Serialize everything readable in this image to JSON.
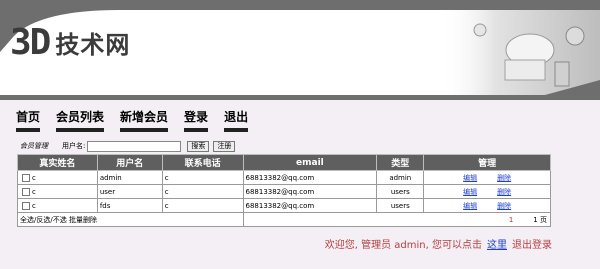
{
  "brand": {
    "mark": "3D",
    "name": "技术网"
  },
  "nav": {
    "items": [
      "首页",
      "会员列表",
      "新增会员",
      "登录",
      "退出"
    ]
  },
  "toolbar": {
    "title": "会员管理",
    "username_label": "用户名:",
    "search_value": "",
    "search_label": "搜索",
    "register_label": "注册"
  },
  "table": {
    "headers": [
      "真实姓名",
      "用户名",
      "联系电话",
      "email",
      "类型",
      "管理"
    ],
    "rows": [
      {
        "realname": "c",
        "username": "admin",
        "phone": "c",
        "email": "68813382@qq.com",
        "type": "admin",
        "edit": "编辑",
        "delete": "删除"
      },
      {
        "realname": "c",
        "username": "user",
        "phone": "c",
        "email": "68813382@qq.com",
        "type": "users",
        "edit": "编辑",
        "delete": "删除"
      },
      {
        "realname": "c",
        "username": "fds",
        "phone": "c",
        "email": "68813382@qq.com",
        "type": "users",
        "edit": "编辑",
        "delete": "删除"
      }
    ],
    "footer": {
      "bulk_actions": "全选/反选/不选  批量删除",
      "page_link": "1",
      "page_total": "1",
      "page_unit": "页"
    }
  },
  "welcome": {
    "prefix": "欢迎您, 管理员 admin, 您可以点击",
    "link": "这里",
    "suffix": "退出登录"
  },
  "colors": {
    "header_band": "#6e6e6e",
    "table_header": "#5f5f5f",
    "page_bg": "#f4eff4",
    "welcome_text": "#b64040",
    "link": "#1d3fd0"
  }
}
